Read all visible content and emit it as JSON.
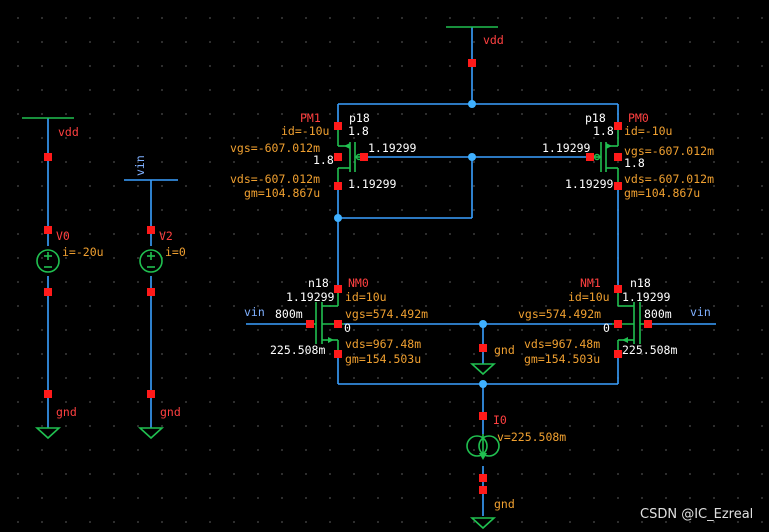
{
  "nets": {
    "vdd_top": "vdd",
    "vdd_left": "vdd",
    "vin_left_src": "vin",
    "vin_left": "vin",
    "vin_right": "vin",
    "gnd_mid": "gnd",
    "gnd_bottom": "gnd",
    "gnd_v0": "gnd",
    "gnd_v2": "gnd"
  },
  "pm1": {
    "name": "PM1",
    "model": "p18",
    "id": "id=-10u",
    "vgs": "vgs=-607.012m",
    "vds": "vds=-607.012m",
    "gm": "gm=104.867u",
    "vs": "1.8",
    "vb": "1.8",
    "vg": "1.19299",
    "vd": "1.19299"
  },
  "pm0": {
    "name": "PM0",
    "model": "p18",
    "id": "id=-10u",
    "vgs": "vgs=-607.012m",
    "vds": "vds=-607.012m",
    "gm": "gm=104.867u",
    "vs": "1.8",
    "vb": "1.8",
    "vg": "1.19299",
    "vd": "1.19299"
  },
  "nm0": {
    "name": "NM0",
    "model": "n18",
    "id": "id=10u",
    "vgs": "vgs=574.492m",
    "vds": "vds=967.48m",
    "gm": "gm=154.503u",
    "vd": "1.19299",
    "vg": "800m",
    "vb": "0",
    "vs": "225.508m"
  },
  "nm1": {
    "name": "NM1",
    "model": "n18",
    "id": "id=10u",
    "vgs": "vgs=574.492m",
    "vds": "vds=967.48m",
    "gm": "gm=154.503u",
    "vd": "1.19299",
    "vg": "800m",
    "vb": "0",
    "vs": "225.508m"
  },
  "v0": {
    "name": "V0",
    "current": "i=-20u"
  },
  "v2": {
    "name": "V2",
    "current": "i=0"
  },
  "i0": {
    "name": "I0",
    "voltage": "v=225.508m"
  },
  "watermark": "CSDN @IC_Ezreal",
  "colors": {
    "background": "#000000",
    "wire": "#3aa0ff",
    "device": "#20c050",
    "pin": "#ff1a1a",
    "annotation": "#f0a030",
    "value": "#ffffff"
  }
}
